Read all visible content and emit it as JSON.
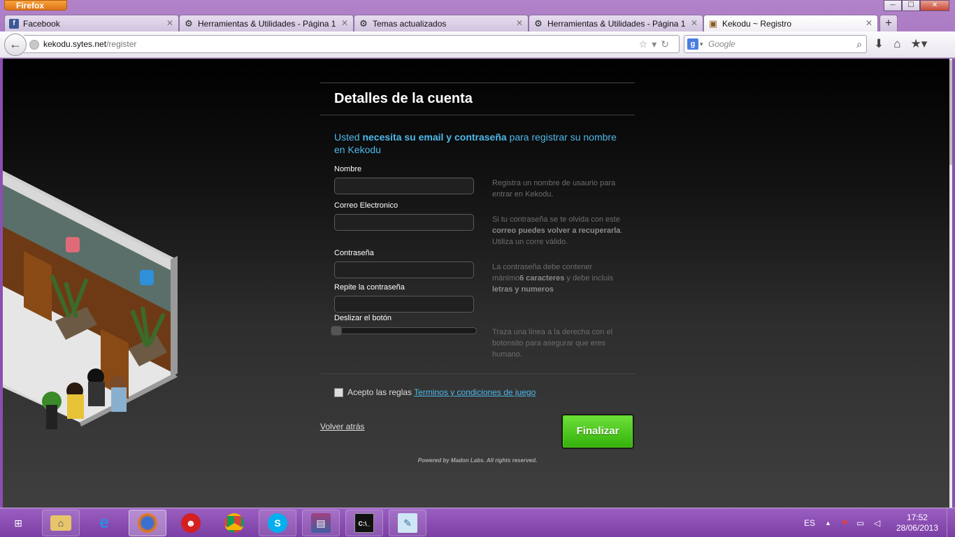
{
  "browser": {
    "menu_button": "Firefox",
    "tabs": [
      {
        "label": "Facebook",
        "icon": "facebook-icon",
        "active": false
      },
      {
        "label": "Herramientas & Utilidades - Página 1",
        "icon": "gear-icon",
        "active": false
      },
      {
        "label": "Temas actualizados",
        "icon": "gear-icon",
        "active": false
      },
      {
        "label": "Herramientas & Utilidades - Página 1",
        "icon": "gear-icon",
        "active": false
      },
      {
        "label": "Kekodu ~ Registro",
        "icon": "box-icon",
        "active": true
      }
    ],
    "url_domain": "kekodu.sytes.net",
    "url_path": "/register",
    "search_placeholder": "Google"
  },
  "form": {
    "title": "Detalles de la cuenta",
    "intro_prefix": "Usted ",
    "intro_bold": "necesita su email y contraseña",
    "intro_suffix": " para registrar su nombre en Kekodu",
    "name_label": "Nombre",
    "name_help": "Registra un nombre de usaurio para entrar en Kekodu.",
    "email_label": "Correo Electronico",
    "email_help_1": "Si tu contraseña se te olvida con este ",
    "email_help_bold": "correo puedes volver a recuperarla",
    "email_help_2": ". Utiliza un corre válido.",
    "password_label": "Contraseña",
    "password_help_1": "La contraseña debe contener mánimo",
    "password_help_bold1": "6 caracteres",
    "password_help_2": " y debe incluis ",
    "password_help_bold2": "letras y numeros",
    "repeat_label": "Repite la contraseña",
    "slider_label": "Deslizar el botón",
    "slider_help": "Traza una línea a la derecha con el botonsito para asegurar que eres humano.",
    "accept_text": "Acepto las reglas ",
    "accept_link": "Terminos y condiciones de juego",
    "back_link": "Volver atrás",
    "finish_button": "Finalizar",
    "powered": "Powered by Madon Labs. All rights reserved."
  },
  "taskbar": {
    "language": "ES",
    "time": "17:52",
    "date": "28/06/2013"
  },
  "colors": {
    "accent_blue": "#4fb8ea",
    "finish_green": "#33b10a",
    "taskbar_purple": "#8a4fb0"
  }
}
